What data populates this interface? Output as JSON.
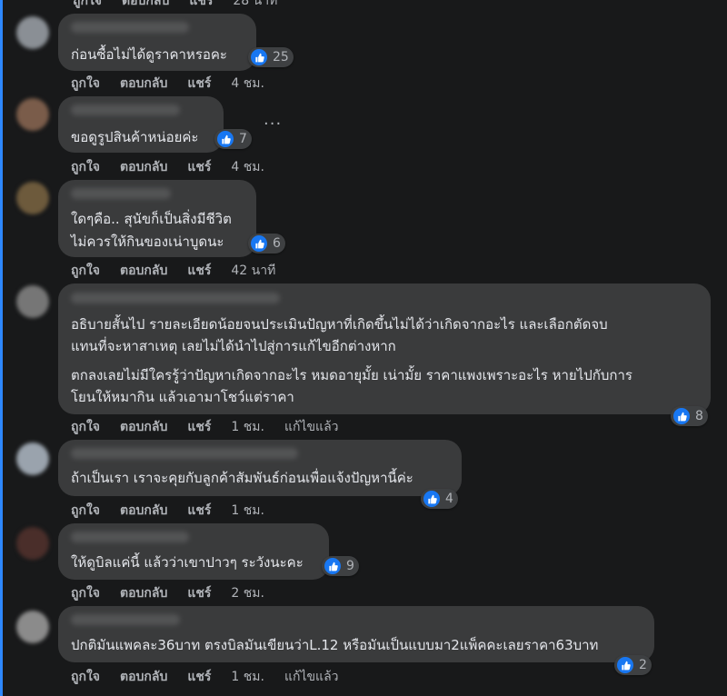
{
  "top": {
    "like": "ถูกใจ",
    "reply": "ตอบกลับ",
    "share": "แชร์",
    "time": "28 นาที"
  },
  "comments": [
    {
      "lines": [
        "ก่อนซื้อไม่ได้ดูราคาหรอคะ"
      ],
      "reactions": "25",
      "actions": {
        "like": "ถูกใจ",
        "reply": "ตอบกลับ",
        "share": "แชร์",
        "time": "4 ชม.",
        "edited": ""
      }
    },
    {
      "lines": [
        "ขอดูรูปสินค้าหน่อยค่ะ"
      ],
      "reactions": "7",
      "more": "···",
      "actions": {
        "like": "ถูกใจ",
        "reply": "ตอบกลับ",
        "share": "แชร์",
        "time": "4 ชม.",
        "edited": ""
      }
    },
    {
      "lines": [
        "ใดๆคือ.. สุนัขก็เป็นสิ่งมีชีวิต",
        "ไม่ควรให้กินของเน่าบูดนะ"
      ],
      "reactions": "6",
      "actions": {
        "like": "ถูกใจ",
        "reply": "ตอบกลับ",
        "share": "แชร์",
        "time": "42 นาที",
        "edited": ""
      }
    },
    {
      "lines": [
        "อธิบายสั้นไป รายละเอียดน้อยจนประเมินปัญหาที่เกิดขึ้นไม่ได้ว่าเกิดจากอะไร และเลือกตัดจบ",
        "แทนที่จะหาสาเหตุ เลยไม่ได้นำไปสู่การแก้ไขอีกต่างหาก",
        "ตกลงเลยไม่มีใครรู้ว่าปัญหาเกิดจากอะไร หมดอายุมั้ย เน่ามั้ย ราคาแพงเพราะอะไร หายไปกับการ",
        "โยนให้หมากิน แล้วเอามาโชว์แต่ราคา"
      ],
      "reactions": "8",
      "actions": {
        "like": "ถูกใจ",
        "reply": "ตอบกลับ",
        "share": "แชร์",
        "time": "1 ชม.",
        "edited": "แก้ไขแล้ว"
      }
    },
    {
      "lines": [
        "ถ้าเป็นเรา เราจะคุยกับลูกค้าสัมพันธ์ก่อนเพื่อแจ้งปัญหานี้ค่ะ"
      ],
      "reactions": "4",
      "actions": {
        "like": "ถูกใจ",
        "reply": "ตอบกลับ",
        "share": "แชร์",
        "time": "1 ชม.",
        "edited": ""
      }
    },
    {
      "lines": [
        "ให้ดูบิลแค่นี้ แล้วว่าเขาปาวๆ ระวังนะคะ"
      ],
      "reactions": "9",
      "actions": {
        "like": "ถูกใจ",
        "reply": "ตอบกลับ",
        "share": "แชร์",
        "time": "2 ชม.",
        "edited": ""
      }
    },
    {
      "lines": [
        "ปกติมันแพคละ36บาท ตรงบิลมันเขียนว่าL.12 หรือมันเป็นแบบมา2แพ็คคะเลยราคา63บาท"
      ],
      "reactions": "2",
      "actions": {
        "like": "ถูกใจ",
        "reply": "ตอบกลับ",
        "share": "แชร์",
        "time": "1 ชม.",
        "edited": "แก้ไขแล้ว"
      }
    }
  ]
}
